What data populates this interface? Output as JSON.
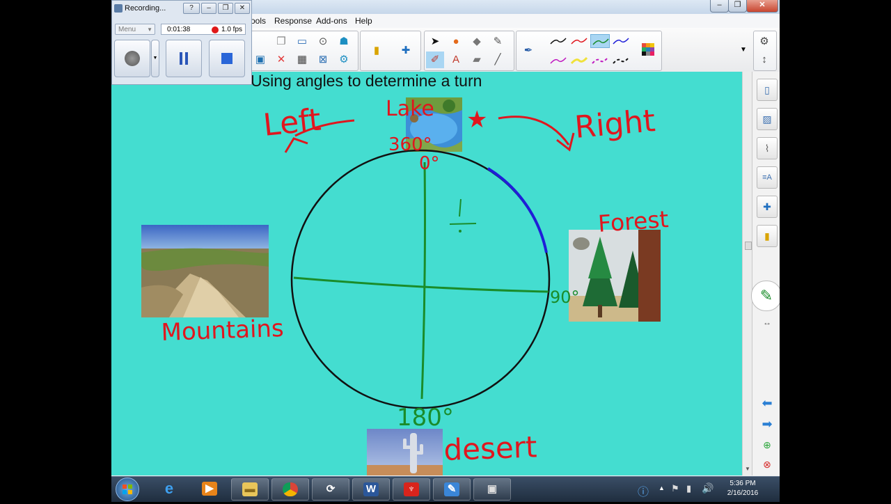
{
  "recorder": {
    "title": "Recording...",
    "menu_label": "Menu",
    "elapsed": "0:01:38",
    "fps": "1.0 fps"
  },
  "window": {
    "minimize_glyph": "–",
    "maximize_glyph": "❐",
    "close_glyph": "✕"
  },
  "menubar": {
    "tools_partial": "ools",
    "response": "Response",
    "addons": "Add-ons",
    "help": "Help"
  },
  "canvas": {
    "background": "#44ddd0",
    "title": "Using angles to determine a turn",
    "annotation_color": "#e0161e",
    "guide_color": "#1a8c2a",
    "arc_color": "#1f1fd8",
    "labels": {
      "lake": "Lake",
      "deg_360": "360°",
      "deg_0": "0°",
      "left": "Left",
      "right": "Right",
      "star": "★",
      "forest": "Forest",
      "deg_90": "90°",
      "mountains": "Mountains",
      "deg_180": "180°",
      "desert": "desert",
      "quarter_fraction": "1/4"
    },
    "images": [
      "lake-photo",
      "mountains-photo",
      "forest-photo",
      "desert-photo"
    ]
  },
  "taskbar": {
    "time": "5:36 PM",
    "date": "2/16/2016",
    "apps": [
      "start",
      "internet-explorer",
      "media-player",
      "file-explorer",
      "chrome",
      "smart-notebook",
      "word",
      "acrobat",
      "notebook-file",
      "recorder"
    ]
  }
}
